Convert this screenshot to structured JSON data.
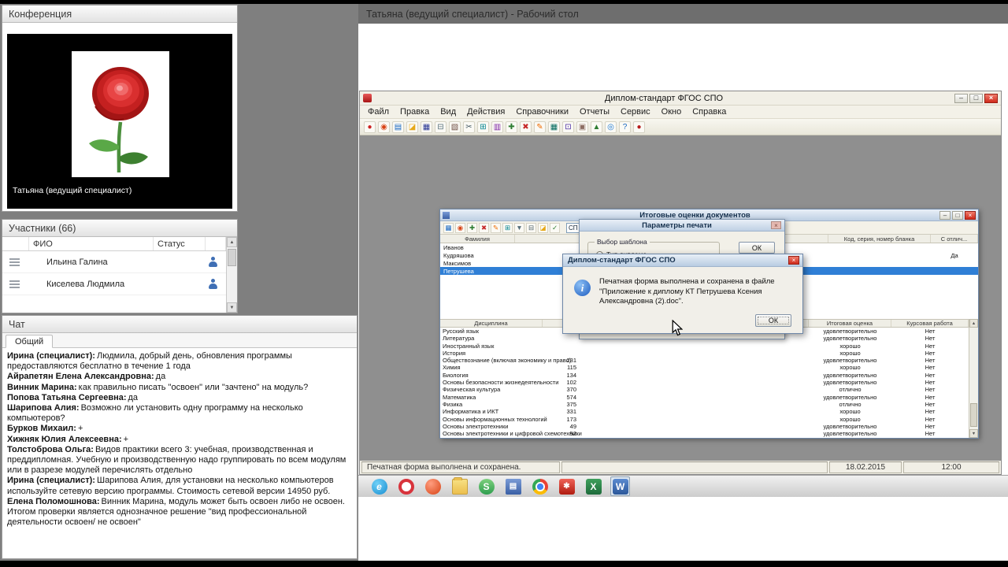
{
  "icons": {
    "scroll_up": "▲",
    "scroll_down": "▼",
    "dropdown": "▾"
  },
  "panels": {
    "conference": {
      "title": "Конференция",
      "caption": "Татьяна (ведущий специалист)"
    },
    "participants": {
      "title": "Участники (66)",
      "columns": [
        "ФИО",
        "Статус"
      ],
      "rows": [
        {
          "name": "Ильина Галина"
        },
        {
          "name": "Киселева Людмила"
        }
      ]
    },
    "chat": {
      "title": "Чат",
      "tab": "Общий",
      "messages": [
        {
          "author": "Ирина (специалист):",
          "text": "Людмила, добрый день, обновления программы предоставляются бесплатно в течение 1 года"
        },
        {
          "author": "Айрапетян Елена Александровна:",
          "text": "да"
        },
        {
          "author": "Винник Марина:",
          "text": "как правильно писать \"освоен\" или \"зачтено\" на модуль?"
        },
        {
          "author": "Попова Татьяна Сергеевна:",
          "text": "да"
        },
        {
          "author": "Шарипова Алия:",
          "text": "Возможно ли установить одну программу на несколько компьютеров?"
        },
        {
          "author": "Бурков Михаил:",
          "text": "+"
        },
        {
          "author": "Хижняк Юлия Алексеевна:",
          "text": "+"
        },
        {
          "author": "Толстоброва Ольга:",
          "text": "Видов практики всего 3: учебная, производственная и преддипломная. Учебную и производственную надо группировать по всем модулям или в разрезе модулей перечислять отдельно"
        },
        {
          "author": "Ирина (специалист):",
          "text": "Шарипова Алия, для установки на несколько компьютеров используйте сетевую версию программы. Стоимость сетевой версии 14950 руб."
        },
        {
          "author": "Елена Поломошнова:",
          "text": "Винник Марина, модуль может быть освоен либо не освоен. Итогом проверки является однозначное решение \"вид профессиональной деятельности освоен/ не освоен\""
        }
      ]
    }
  },
  "share": {
    "header": "Татьяна (ведущий специалист) - Рабочий стол"
  },
  "app": {
    "title": "Диплом-стандарт ФГОС СПО",
    "menu": [
      "Файл",
      "Правка",
      "Вид",
      "Действия",
      "Справочники",
      "Отчеты",
      "Сервис",
      "Окно",
      "Справка"
    ],
    "window_buttons": {
      "minimize": "–",
      "maximize": "□",
      "close": "×"
    },
    "toolbar": [
      {
        "name": "logo-icon",
        "glyph": "●",
        "fg": "#cc2222"
      },
      {
        "name": "refresh-icon",
        "glyph": "◉",
        "fg": "#d84315"
      },
      {
        "name": "new-doc-icon",
        "glyph": "▤",
        "fg": "#1565c0"
      },
      {
        "name": "open-folder-icon",
        "glyph": "◪",
        "fg": "#e6a817"
      },
      {
        "name": "save-icon",
        "glyph": "▦",
        "fg": "#283593"
      },
      {
        "name": "print-icon",
        "glyph": "⊟",
        "fg": "#546e7a"
      },
      {
        "name": "preview-icon",
        "glyph": "▧",
        "fg": "#6d4c41"
      },
      {
        "name": "cut-icon",
        "glyph": "✂",
        "fg": "#455a64"
      },
      {
        "name": "copy-icon",
        "glyph": "⊞",
        "fg": "#00838f"
      },
      {
        "name": "paste-icon",
        "glyph": "▥",
        "fg": "#7b1fa2"
      },
      {
        "name": "add-icon",
        "glyph": "✚",
        "fg": "#2e7d32"
      },
      {
        "name": "delete-icon",
        "glyph": "✖",
        "fg": "#c62828"
      },
      {
        "name": "edit-icon",
        "glyph": "✎",
        "fg": "#ef6c00"
      },
      {
        "name": "table-icon",
        "glyph": "▦",
        "fg": "#00695c"
      },
      {
        "name": "calc-icon",
        "glyph": "⊡",
        "fg": "#4527a0"
      },
      {
        "name": "book-icon",
        "glyph": "▣",
        "fg": "#8d6e63"
      },
      {
        "name": "chart-icon",
        "glyph": "▲",
        "fg": "#2e7d32"
      },
      {
        "name": "globe-icon",
        "glyph": "◎",
        "fg": "#1976d2"
      },
      {
        "name": "help-icon",
        "glyph": "?",
        "fg": "#1565c0"
      },
      {
        "name": "exit-icon",
        "glyph": "●",
        "fg": "#b71c1c"
      }
    ],
    "status": {
      "message": "Печатная форма выполнена и сохранена.",
      "date": "18.02.2015",
      "time": "12:00"
    }
  },
  "grades": {
    "title": "Итоговые оценки документов",
    "combo_value": "СП",
    "toolbar": [
      {
        "name": "grid-icon",
        "glyph": "▦",
        "fg": "#1565c0"
      },
      {
        "name": "refresh-icon",
        "glyph": "◉",
        "fg": "#d84315"
      },
      {
        "name": "add-row-icon",
        "glyph": "✚",
        "fg": "#2e7d32"
      },
      {
        "name": "delete-row-icon",
        "glyph": "✖",
        "fg": "#c62828"
      },
      {
        "name": "edit-row-icon",
        "glyph": "✎",
        "fg": "#ef6c00"
      },
      {
        "name": "copy-icon",
        "glyph": "⊞",
        "fg": "#00838f"
      },
      {
        "name": "filter-icon",
        "glyph": "▼",
        "fg": "#546e7a"
      },
      {
        "name": "print-icon",
        "glyph": "⊟",
        "fg": "#455a64"
      },
      {
        "name": "export-icon",
        "glyph": "◪",
        "fg": "#e6a817"
      },
      {
        "name": "check-icon",
        "glyph": "✓",
        "fg": "#2e7d32"
      }
    ],
    "students": {
      "columns": [
        "Фамилия",
        "Код, серия, номер бланка",
        "С отлич..."
      ],
      "rows": [
        {
          "surname": "Иванов",
          "otl": ""
        },
        {
          "surname": "Кудряшова",
          "otl": "Да"
        },
        {
          "surname": "Максимов",
          "otl": ""
        },
        {
          "surname": "Петрушева",
          "otl": "",
          "state": "selected"
        }
      ]
    },
    "subjects": {
      "columns": [
        "Дисциплина",
        "Итоговая оценка",
        "Курсовая работа"
      ],
      "rows": [
        {
          "name": "Русский язык",
          "hours": "",
          "grade": "удовлетворительно",
          "course": "Нет"
        },
        {
          "name": "Литература",
          "hours": "",
          "grade": "удовлетворительно",
          "course": "Нет"
        },
        {
          "name": "Иностранный язык",
          "hours": "",
          "grade": "хорошо",
          "course": "Нет"
        },
        {
          "name": "История",
          "hours": "",
          "grade": "хорошо",
          "course": "Нет"
        },
        {
          "name": "Обществознание (включая экономику и право)",
          "hours": "231",
          "grade": "удовлетворительно",
          "course": "Нет"
        },
        {
          "name": "Химия",
          "hours": "115",
          "grade": "хорошо",
          "course": "Нет"
        },
        {
          "name": "Биология",
          "hours": "134",
          "grade": "удовлетворительно",
          "course": "Нет"
        },
        {
          "name": "Основы безопасности жизнедеятельности",
          "hours": "102",
          "grade": "удовлетворительно",
          "course": "Нет"
        },
        {
          "name": "Физическая культура",
          "hours": "370",
          "grade": "отлично",
          "course": "Нет"
        },
        {
          "name": "Математика",
          "hours": "574",
          "grade": "удовлетворительно",
          "course": "Нет"
        },
        {
          "name": "Физика",
          "hours": "375",
          "grade": "отлично",
          "course": "Нет"
        },
        {
          "name": "Информатика и ИКТ",
          "hours": "331",
          "grade": "хорошо",
          "course": "Нет"
        },
        {
          "name": "Основы информационных технологий",
          "hours": "173",
          "grade": "хорошо",
          "course": "Нет"
        },
        {
          "name": "Основы электротехники",
          "hours": "49",
          "grade": "удовлетворительно",
          "course": "Нет"
        },
        {
          "name": "Основы электротехники и цифровой схемотехники",
          "hours": "52",
          "grade": "удовлетворительно",
          "course": "Нет"
        }
      ]
    }
  },
  "print_dialog": {
    "title": "Параметры печати",
    "group_label": "Выбор шаблона",
    "radio_label": "Тип диплома",
    "ok": "ОК",
    "close": "×"
  },
  "message_box": {
    "title": "Диплом-стандарт ФГОС СПО",
    "info_glyph": "i",
    "text": "Печатная форма выполнена и сохранена в файле \"Приложение к диплому КТ Петрушева Ксения Александровна (2).doc\".",
    "ok": "ОК",
    "close": "×"
  },
  "taskbar": {
    "icons": [
      {
        "name": "internet-explorer-icon",
        "kind": "ie",
        "glyph": "e"
      },
      {
        "name": "opera-icon",
        "kind": "opera",
        "glyph": ""
      },
      {
        "name": "browser-red-icon",
        "kind": "redball",
        "glyph": ""
      },
      {
        "name": "folder-icon",
        "kind": "folder",
        "glyph": ""
      },
      {
        "name": "messenger-green-icon",
        "kind": "green",
        "glyph": "S"
      },
      {
        "name": "address-book-icon",
        "kind": "book",
        "glyph": "▤"
      },
      {
        "name": "chrome-icon",
        "kind": "chrome",
        "glyph": ""
      },
      {
        "name": "diplom-app-icon",
        "kind": "redapp",
        "glyph": "✱"
      },
      {
        "name": "excel-icon",
        "kind": "excel",
        "glyph": "X"
      },
      {
        "name": "word-icon",
        "kind": "word",
        "glyph": "W",
        "state": "active"
      }
    ]
  }
}
